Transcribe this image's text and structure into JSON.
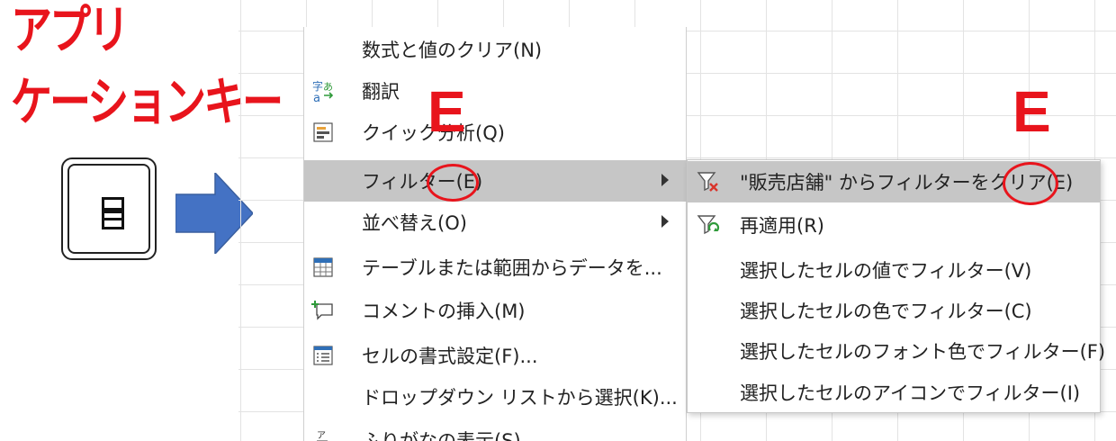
{
  "title": {
    "line1": "アプリ",
    "line2": "ケーションキー"
  },
  "context_menu": {
    "items": [
      {
        "label": "数式と値のクリア(N)",
        "icon": "none"
      },
      {
        "label": "翻訳",
        "icon": "translate-icon"
      },
      {
        "label": "クイック分析(Q)",
        "icon": "quick-analysis-icon"
      },
      {
        "label": "フィルター(E)",
        "icon": "none",
        "submenu": true,
        "highlighted": true
      },
      {
        "label": "並べ替え(O)",
        "icon": "none",
        "submenu": true
      },
      {
        "label": "テーブルまたは範囲からデータを...",
        "icon": "table-icon"
      },
      {
        "label": "コメントの挿入(M)",
        "icon": "comment-icon"
      },
      {
        "label": "セルの書式設定(F)...",
        "icon": "format-cells-icon"
      },
      {
        "label": "ドロップダウン リストから選択(K)...",
        "icon": "none"
      },
      {
        "label": "ふりがなの表示(S)",
        "icon": "furigana-icon"
      }
    ]
  },
  "filter_submenu": {
    "items": [
      {
        "label": "\"販売店舗\" からフィルターをクリア(E)",
        "icon": "clear-filter-icon",
        "highlighted": true
      },
      {
        "label": "再適用(R)",
        "icon": "reapply-filter-icon"
      },
      {
        "label": "選択したセルの値でフィルター(V)",
        "icon": "none"
      },
      {
        "label": "選択したセルの色でフィルター(C)",
        "icon": "none"
      },
      {
        "label": "選択したセルのフォント色でフィルター(F)",
        "icon": "none"
      },
      {
        "label": "選択したセルのアイコンでフィルター(I)",
        "icon": "none"
      }
    ]
  },
  "annotations": {
    "e_left": "E",
    "e_right": "E"
  },
  "colors": {
    "accent_red": "#e8141c",
    "arrow_blue": "#4472c4",
    "highlight": "#c6c6c6"
  }
}
